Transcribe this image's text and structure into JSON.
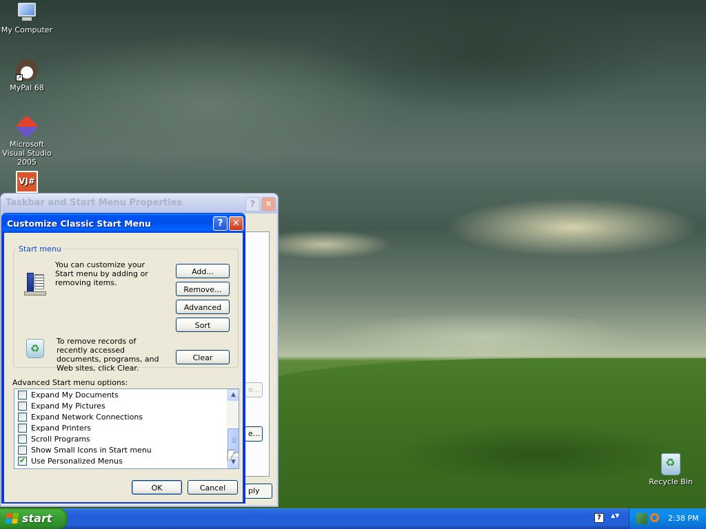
{
  "desktop": {
    "icons": [
      {
        "label": "My Computer",
        "icon": "my-computer-icon"
      },
      {
        "label": "MyPal 68",
        "icon": "mypal-icon"
      },
      {
        "label": "Microsoft Visual Studio 2005",
        "icon": "visual-studio-icon"
      },
      {
        "label": "VJ#",
        "icon": "vjsharp-icon"
      },
      {
        "label": "Recycle Bin",
        "icon": "recycle-bin-icon"
      }
    ]
  },
  "back_window": {
    "title": "Taskbar and Start Menu Properties",
    "help_glyph": "?",
    "close_glyph": "✕",
    "partial_buttons": [
      "e...",
      "e...",
      "ply"
    ]
  },
  "dialog": {
    "title": "Customize Classic Start Menu",
    "help_glyph": "?",
    "close_glyph": "✕",
    "start_menu_group": {
      "legend": "Start menu",
      "description": "You can customize your Start menu by adding or removing items.",
      "buttons": [
        "Add...",
        "Remove...",
        "Advanced",
        "Sort"
      ],
      "clear_text": "To remove records of recently accessed documents, programs, and Web sites, click Clear.",
      "clear_button": "Clear"
    },
    "advanced_label": "Advanced Start menu options:",
    "options": [
      {
        "label": "Expand My Documents",
        "checked": false
      },
      {
        "label": "Expand My Pictures",
        "checked": false
      },
      {
        "label": "Expand Network Connections",
        "checked": false
      },
      {
        "label": "Expand Printers",
        "checked": false
      },
      {
        "label": "Scroll Programs",
        "checked": false
      },
      {
        "label": "Show Small Icons in Start menu",
        "checked": false
      },
      {
        "label": "Use Personalized Menus",
        "checked": true
      }
    ],
    "ok_button": "OK",
    "cancel_button": "Cancel"
  },
  "taskbar": {
    "start_label": "start",
    "clock": "2:38 PM",
    "notify_glyph": "?",
    "expand_glyph": "▲▼"
  },
  "colors": {
    "title_active": "#0054e3",
    "taskbar_blue": "#245edb",
    "start_green": "#3c9e36",
    "group_legend": "#0046d5"
  }
}
